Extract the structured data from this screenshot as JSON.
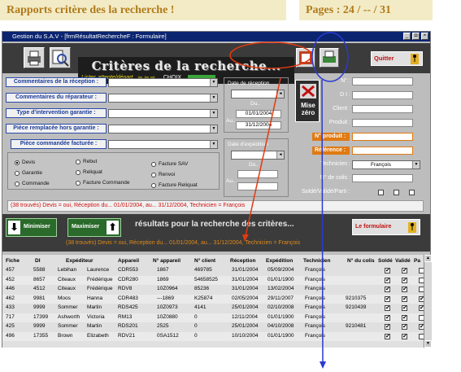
{
  "header": {
    "banner_left": "Rapports critère des la recherche !",
    "banner_right": "Pages : 24 / -- / 31"
  },
  "window": {
    "title": "Gestion du S.A.V - [frmRésultatRechercheF : Formulaire]",
    "btn_min": "_",
    "btn_max": "◘",
    "btn_close": "×"
  },
  "top": {
    "main_title": "Critères de la recherche...",
    "sub_lists": "Listes attente/départ",
    "sub_choix": "CHOIX",
    "quit_label": "Quitter",
    "mise_zero_label": "Mise zéro"
  },
  "criteria": {
    "labels": [
      "Commentaires de la réception :",
      "Commentaires du réparateur :",
      "Type d'intervention garantie :",
      "Pièce remplacée hors garantie :",
      "Pièce commandée facturée :"
    ]
  },
  "dates": {
    "reception_label": "Date de réception",
    "du_label": "Du..",
    "au_label": "Au..",
    "date_from": "01/01/2004",
    "date_to": "31/12/2004",
    "expedition_label": "Date d'expédition",
    "exp_du_label": "Du..",
    "exp_au_label": "Au.."
  },
  "radios": [
    {
      "label": "Devis",
      "checked": true
    },
    {
      "label": "Rebut",
      "checked": false
    },
    {
      "label": "Facture SAV",
      "checked": false
    },
    {
      "label": "Garantie",
      "checked": false
    },
    {
      "label": "Reliquat",
      "checked": false
    },
    {
      "label": "Renvoi",
      "checked": false
    },
    {
      "label": "Commande",
      "checked": false
    },
    {
      "label": "Facture Commande",
      "checked": false
    },
    {
      "label": "Facture Reliquat",
      "checked": false
    }
  ],
  "right_panel": {
    "n_label": "N° :",
    "di_label": "D I :",
    "client_label": "Client :",
    "produit_label": "Produit :",
    "n_produit_label": "N° produit :",
    "reference_label": "Référence :",
    "technicien_label": "Technicien :",
    "technicien_value": "François",
    "n_de_colis_label": "N° de colis :",
    "solde_label": "Soldé/Validé/Parti :"
  },
  "summary_line": "(38 trouvés)  Devis = oui, Réception du... 01/01/2004, au... 31/12/2004, Technicien = François",
  "results": {
    "btn_minimiser": "Minimiser",
    "btn_maximiser": "Maximiser",
    "title": "résultats pour la recherche des critères...",
    "formulaire_label": "Le formulaire",
    "sub": "(38 trouvés)  Devis = oui, Réception du... 01/01/2004, au... 31/12/2004, Technicien = François"
  },
  "table": {
    "columns": [
      "Fiche",
      "DI",
      "Expéditeur",
      "",
      "Appareil",
      "N° appareil",
      "N° client",
      "Réception",
      "Expédition",
      "Technicien",
      "N° du colis",
      "Soldé",
      "Validé",
      "Pa"
    ],
    "rows": [
      [
        "457",
        "5588",
        "Lebihan",
        "Laurence",
        "CDR553",
        "1867",
        "469785",
        "31/01/2004",
        "05/09/2004",
        "François",
        "",
        "1",
        "1",
        "0"
      ],
      [
        "452",
        "8657",
        "Citeaux",
        "Frédérique",
        "CDR280",
        "1869",
        "54658525",
        "31/01/2004",
        "01/01/1900",
        "François",
        "",
        "1",
        "1",
        "0"
      ],
      [
        "446",
        "4512",
        "Citeaux",
        "Frédérique",
        "RDV8",
        "10Z0964",
        "85236",
        "31/01/2004",
        "13/02/2004",
        "François",
        "",
        "1",
        "1",
        "0"
      ],
      [
        "462",
        "9981",
        "Moos",
        "Hanna",
        "CDR483",
        "---1869",
        "K25874",
        "02/05/2004",
        "29/11/2007",
        "François",
        "9210375",
        "1",
        "1",
        "1"
      ],
      [
        "433",
        "9999",
        "Sommer",
        "Martin",
        "RDS425",
        "10Z0973",
        "4141",
        "25/01/2004",
        "02/10/2008",
        "François",
        "9210439",
        "1",
        "1",
        "1"
      ],
      [
        "717",
        "17399",
        "Ashworth",
        "Victoria",
        "RM13",
        "10Z0880",
        "0",
        "12/11/2004",
        "01/01/1900",
        "François",
        "",
        "1",
        "1",
        "0"
      ],
      [
        "425",
        "9999",
        "Sommer",
        "Martin",
        "RDS201",
        "2525",
        "0",
        "25/01/2004",
        "04/10/2008",
        "François",
        "9210481",
        "1",
        "1",
        "1"
      ],
      [
        "496",
        "17355",
        "Brown",
        "Elizabeth",
        "RDV21",
        "0SA1512",
        "0",
        "10/10/2004",
        "01/01/1900",
        "François",
        "",
        "1",
        "1",
        "0"
      ]
    ]
  },
  "colors": {
    "accent_orange": "#e07a12",
    "accent_blue_border": "#2b4aa8",
    "alert_red": "#cc1010",
    "annotation_red": "#e03a10",
    "annotation_blue": "#2a3ad0"
  }
}
